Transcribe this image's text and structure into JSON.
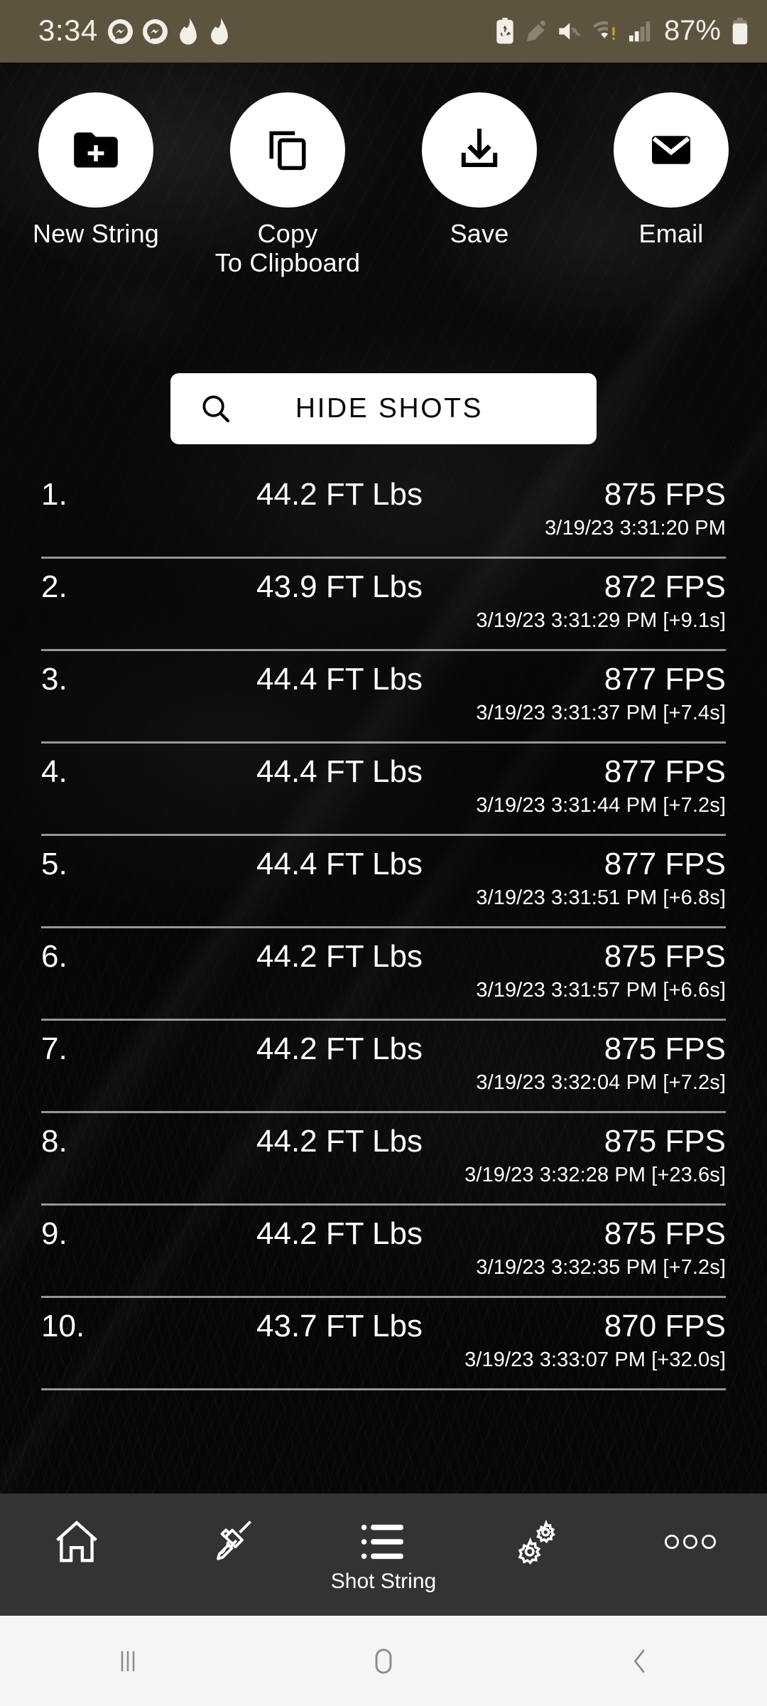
{
  "status_bar": {
    "time": "3:34",
    "battery_percent": "87%",
    "left_icons": [
      "messenger-icon",
      "messenger-icon",
      "flame-icon",
      "flame-icon"
    ],
    "right_icons": [
      "battery-saver-icon",
      "stylus-icon",
      "mute-icon",
      "wifi-warning-icon",
      "signal-bars-icon"
    ],
    "background_color": "#5d5440",
    "foreground_color": "#f2efe8"
  },
  "actions": [
    {
      "icon": "folder-plus-icon",
      "label": "New String"
    },
    {
      "icon": "copy-icon",
      "label": "Copy\nTo Clipboard",
      "label_line1": "Copy",
      "label_line2": "To Clipboard"
    },
    {
      "icon": "download-icon",
      "label": "Save"
    },
    {
      "icon": "envelope-icon",
      "label": "Email"
    }
  ],
  "hide_shots": {
    "icon": "search-icon",
    "label": "HIDE SHOTS"
  },
  "shot_list": {
    "columns": [
      "index",
      "energy",
      "speed",
      "timestamp"
    ],
    "rows": [
      {
        "index": "1.",
        "energy": "44.2 FT Lbs",
        "speed": "875 FPS",
        "timestamp": "3/19/23 3:31:20 PM"
      },
      {
        "index": "2.",
        "energy": "43.9 FT Lbs",
        "speed": "872 FPS",
        "timestamp": "3/19/23 3:31:29 PM [+9.1s]"
      },
      {
        "index": "3.",
        "energy": "44.4 FT Lbs",
        "speed": "877 FPS",
        "timestamp": "3/19/23 3:31:37 PM [+7.4s]"
      },
      {
        "index": "4.",
        "energy": "44.4 FT Lbs",
        "speed": "877 FPS",
        "timestamp": "3/19/23 3:31:44 PM [+7.2s]"
      },
      {
        "index": "5.",
        "energy": "44.4 FT Lbs",
        "speed": "877 FPS",
        "timestamp": "3/19/23 3:31:51 PM [+6.8s]"
      },
      {
        "index": "6.",
        "energy": "44.2 FT Lbs",
        "speed": "875 FPS",
        "timestamp": "3/19/23 3:31:57 PM [+6.6s]"
      },
      {
        "index": "7.",
        "energy": "44.2 FT Lbs",
        "speed": "875 FPS",
        "timestamp": "3/19/23 3:32:04 PM [+7.2s]"
      },
      {
        "index": "8.",
        "energy": "44.2 FT Lbs",
        "speed": "875 FPS",
        "timestamp": "3/19/23 3:32:28 PM [+23.6s]"
      },
      {
        "index": "9.",
        "energy": "44.2 FT Lbs",
        "speed": "875 FPS",
        "timestamp": "3/19/23 3:32:35 PM [+7.2s]"
      },
      {
        "index": "10.",
        "energy": "43.7 FT Lbs",
        "speed": "870 FPS",
        "timestamp": "3/19/23 3:33:07 PM [+32.0s]"
      }
    ]
  },
  "bottom_nav": {
    "background_color": "#333333",
    "items": [
      {
        "icon": "home-icon",
        "label": "",
        "active": false
      },
      {
        "icon": "rifle-icon",
        "label": "",
        "active": false
      },
      {
        "icon": "list-icon",
        "label": "Shot String",
        "active": true
      },
      {
        "icon": "gears-icon",
        "label": "",
        "active": false
      },
      {
        "icon": "more-dots-icon",
        "label": "",
        "active": false
      }
    ]
  },
  "system_nav": {
    "background_color": "#f5f5f5",
    "items": [
      {
        "icon": "recents-icon"
      },
      {
        "icon": "home-pill-icon"
      },
      {
        "icon": "back-chevron-icon"
      }
    ]
  }
}
